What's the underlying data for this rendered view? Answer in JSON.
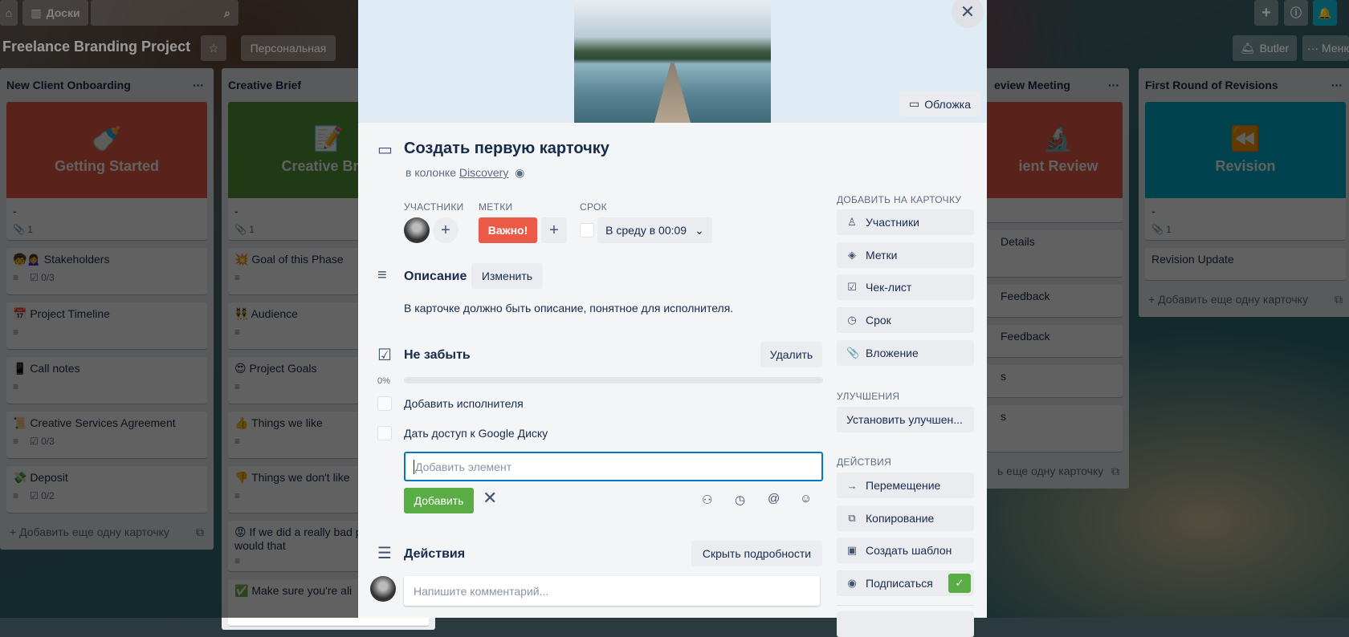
{
  "header": {
    "boards_label": "Доски",
    "board_title": "Freelance Branding Project",
    "visibility": "Персональная",
    "butler": "Butler",
    "menu": "Меню"
  },
  "lists": [
    {
      "title": "New Client Onboarding",
      "add": "Добавить еще одну карточку",
      "cards": [
        {
          "cover": {
            "color": "#eb5a46",
            "emoji": "🍼",
            "title": "Getting Started"
          },
          "title": "-",
          "attach": "1"
        },
        {
          "title": "🧒🙍‍♀️ Stakeholders",
          "desc": true,
          "check": "0/3"
        },
        {
          "title": "📅 Project Timeline",
          "desc": true
        },
        {
          "title": "📱 Call notes",
          "desc": true
        },
        {
          "title": "📜 Creative Services Agreement",
          "desc": true,
          "check": "0/3"
        },
        {
          "title": "💸 Deposit",
          "desc": true,
          "check": "0/2"
        }
      ]
    },
    {
      "title": "Creative Brief",
      "cards": [
        {
          "cover": {
            "color": "#519839",
            "emoji": "📝",
            "title": "Creative Brief"
          },
          "title": "-",
          "attach": "1"
        },
        {
          "title": "💥 Goal of this Phase",
          "desc": true
        },
        {
          "title": "👯 Audience",
          "desc": true
        },
        {
          "title": "😍 Project Goals",
          "desc": true
        },
        {
          "title": "👍 Things we like",
          "desc": true
        },
        {
          "title": "👎 Things we don't like",
          "desc": true
        },
        {
          "title": "😡 If we did a really bad project, what would that",
          "desc": true
        },
        {
          "title": "✅ Make sure you're ali"
        }
      ]
    },
    {
      "title": "eview Meeting",
      "add": "ь еще одну карточку",
      "cards": [
        {
          "cover": {
            "color": "#eb5a46",
            "emoji": "🔬",
            "title": "ient Review"
          },
          "title": ""
        },
        {
          "title": "Details"
        },
        {
          "title": "Feedback",
          "short": true
        },
        {
          "title": "Feedback",
          "short": true
        },
        {
          "title": "s",
          "short": true
        },
        {
          "title": "s"
        }
      ]
    },
    {
      "title": "First Round of Revisions",
      "add": "Добавить еще одну карточку",
      "cards": [
        {
          "cover": {
            "color": "#00aecc",
            "emoji": "⏪",
            "title": "Revision"
          },
          "title": "-",
          "attach": "1"
        },
        {
          "title": "Revision Update",
          "short": true
        }
      ]
    }
  ],
  "modal": {
    "cover_button": "Обложка",
    "title": "Создать первую карточку",
    "in_list_prefix": "в колонке",
    "list_name": "Discovery",
    "members_label": "УЧАСТНИКИ",
    "labels_label": "МЕТКИ",
    "due_label": "СРОК",
    "label_chip": {
      "text": "Важно!",
      "color": "#eb5a46"
    },
    "due_value": "В среду в 00:09",
    "due_done": false,
    "description_title": "Описание",
    "edit_button": "Изменить",
    "description": "В карточке должно быть описание, понятное для исполнителя.",
    "checklist": {
      "title": "Не забыть",
      "delete": "Удалить",
      "progress": 0,
      "progress_text": "0%",
      "items": [
        {
          "text": "Добавить исполнителя",
          "checked": false
        },
        {
          "text": "Дать доступ к Google Диску",
          "checked": false
        }
      ],
      "input_placeholder": "Добавить элемент",
      "add_button": "Добавить"
    },
    "activity_title": "Действия",
    "hide_details": "Скрыть подробности",
    "comment_placeholder": "Напишите комментарий...",
    "sidebar": {
      "add_title": "ДОБАВИТЬ НА КАРТОЧКУ",
      "add_items": [
        "Участники",
        "Метки",
        "Чек-лист",
        "Срок",
        "Вложение"
      ],
      "powerups_title": "УЛУЧШЕНИЯ",
      "powerups_button": "Установить улучшен...",
      "actions_title": "ДЕЙСТВИЯ",
      "action_items": [
        "Перемещение",
        "Копирование",
        "Создать шаблон",
        "Подписаться"
      ],
      "subscribed": true
    }
  },
  "colors": {
    "green": "#5aac44",
    "accent_border": "#0079bf"
  }
}
